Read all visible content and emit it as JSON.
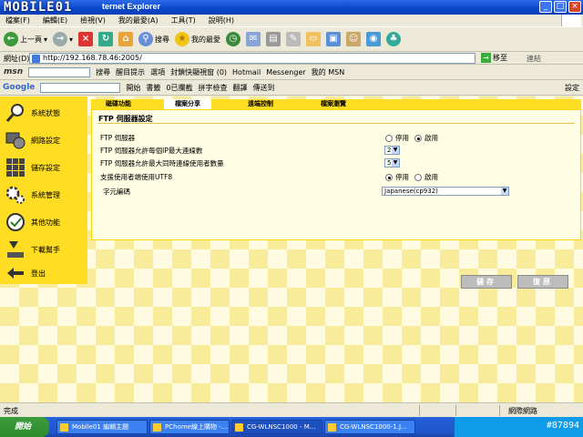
{
  "browser": {
    "title_partial": "ternet Explorer",
    "watermark": "MOBILE01",
    "menu": [
      "檔案(F)",
      "編輯(E)",
      "檢視(V)",
      "我的最愛(A)",
      "工具(T)",
      "說明(H)"
    ],
    "toolbar": {
      "back": "上一頁",
      "search": "搜尋",
      "favorites": "我的最愛"
    },
    "address": {
      "label": "網址(D)",
      "url": "http://192.168.78.46:2005/",
      "go": "移至",
      "links": "連結"
    },
    "msnbar": {
      "logo": "msn",
      "search": "搜尋",
      "highlight": "醒目提示",
      "options": "選項",
      "popup": "封鎖快顯視窗 (0)",
      "hotmail": "Hotmail",
      "messenger": "Messenger",
      "mymsn": "我的 MSN"
    },
    "googlebar": {
      "logo": "Google",
      "start": "開始",
      "bookmarks": "書籤",
      "blocked": "0已攔截",
      "spell": "拼字檢查",
      "translate": "翻譯",
      "send": "傳送到",
      "settings": "設定"
    }
  },
  "router": {
    "sidebar": [
      {
        "label": "系統狀態",
        "icon": "magnifier-icon"
      },
      {
        "label": "網路設定",
        "icon": "network-icon"
      },
      {
        "label": "儲存設定",
        "icon": "storage-grid-icon"
      },
      {
        "label": "系統管理",
        "icon": "gears-icon"
      },
      {
        "label": "其他功能",
        "icon": "clock-icon"
      },
      {
        "label": "下載幫手",
        "icon": "download-icon"
      },
      {
        "label": "登出",
        "icon": "logout-arrow-icon"
      }
    ],
    "tabs": [
      "磁碟功能",
      "檔案分享",
      "遠端控制",
      "檔案瀏覽"
    ],
    "active_tab": "檔案分享",
    "panel": {
      "title": "FTP 伺服器設定",
      "rows": {
        "ftp_server": {
          "label": "FTP 伺服器",
          "opt_off": "停用",
          "opt_on": "啟用",
          "selected": "啟用"
        },
        "max_per_ip": {
          "label": "FTP 伺服器允許每個IP最大連線數",
          "value": "2"
        },
        "max_users": {
          "label": "FTP 伺服器允許最大同時連線使用者數量",
          "value": "5"
        },
        "utf8": {
          "label": "支援使用者端使用UTF8",
          "opt_off": "停用",
          "opt_on": "啟用",
          "selected": "停用"
        },
        "encoding": {
          "label": "字元編碼",
          "value": "Japanese(cp932)"
        }
      }
    },
    "buttons": {
      "save": "儲存",
      "restore": "復原"
    }
  },
  "status": {
    "text": "完成",
    "zone": "網際網路"
  },
  "taskbar": {
    "start": "開始",
    "tasks": [
      "Mobile01 編輯主題",
      "PChome線上購物 -...",
      "CG-WLNSC1000 - M...",
      "CG-WLNSC1000-1.J..."
    ],
    "clock": "#87894"
  }
}
